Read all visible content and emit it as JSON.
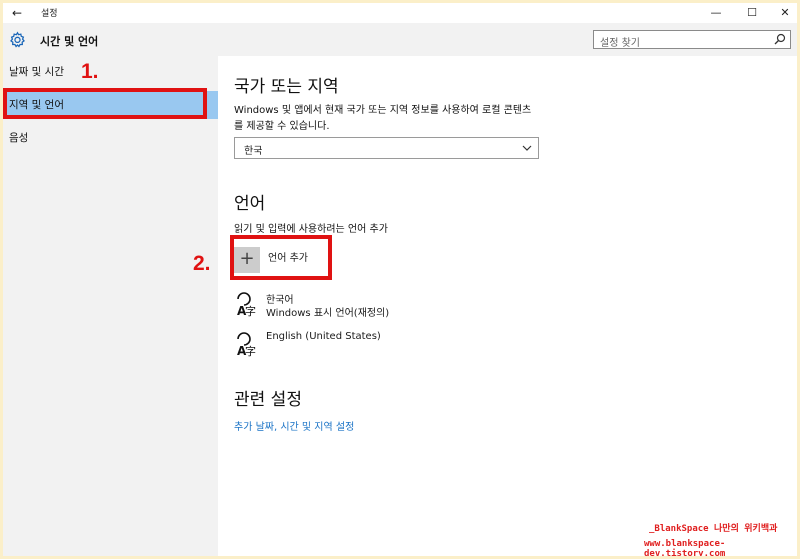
{
  "window": {
    "title": "설정",
    "back_glyph": "←",
    "minimize_glyph": "—",
    "maximize_glyph": "☐",
    "close_glyph": "✕"
  },
  "header": {
    "title": "시간 및 언어",
    "search_placeholder": "설정 찾기"
  },
  "sidebar": {
    "items": [
      {
        "label": "날짜 및 시간",
        "selected": false
      },
      {
        "label": "지역 및 언어",
        "selected": true
      },
      {
        "label": "음성",
        "selected": false
      }
    ]
  },
  "main": {
    "region": {
      "heading": "국가 또는 지역",
      "description": "Windows 및 앱에서 현재 국가 또는 지역 정보를 사용하여 로컬 콘텐츠를 제공할 수 있습니다.",
      "selected_country": "한국"
    },
    "language": {
      "heading": "언어",
      "description": "읽기 및 입력에 사용하려는 언어 추가",
      "add_label": "언어 추가",
      "add_glyph": "+",
      "languages": [
        {
          "name": "한국어",
          "sub": "Windows 표시 언어(재정의)"
        },
        {
          "name": "English (United States)",
          "sub": ""
        }
      ]
    },
    "related": {
      "heading": "관련 설정",
      "link": "추가 날짜, 시간 및 지역 설정"
    }
  },
  "annotations": {
    "step1": "1.",
    "step2": "2.",
    "color": "#e01212"
  },
  "watermark": {
    "line1": "_BlankSpace 나만의 위키백과",
    "line2": "www.blankspace-dev.tistory.com"
  },
  "colors": {
    "selected_bg": "#99c8f0",
    "sidebar_bg": "#f2f2f2",
    "link": "#1a73c6",
    "page_border": "#fbefc9"
  }
}
